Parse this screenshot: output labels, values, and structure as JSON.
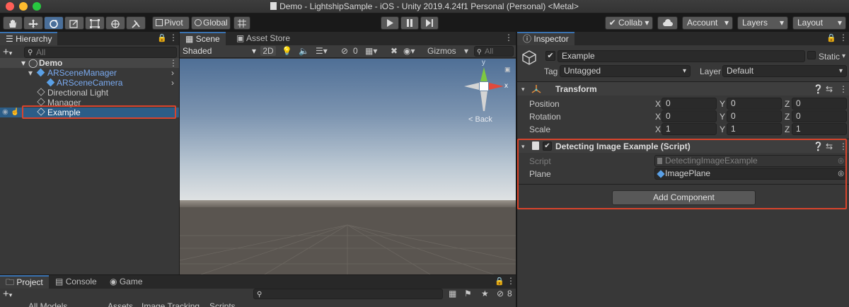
{
  "window": {
    "title": "Demo - LightshipSample - iOS - Unity 2019.4.24f1 Personal (Personal) <Metal>"
  },
  "toolbar": {
    "pivot_label": "Pivot",
    "global_label": "Global",
    "collab_label": "Collab",
    "account_label": "Account",
    "layers_label": "Layers",
    "layout_label": "Layout"
  },
  "hierarchy": {
    "tab_label": "Hierarchy",
    "search_placeholder": "All",
    "items": [
      {
        "label": "Demo"
      },
      {
        "label": "ARSceneManager"
      },
      {
        "label": "ARSceneCamera"
      },
      {
        "label": "Directional Light"
      },
      {
        "label": "Manager"
      },
      {
        "label": "Example"
      }
    ]
  },
  "scene": {
    "tabs": [
      "Scene",
      "Asset Store"
    ],
    "shading_mode": "Shaded",
    "mode_2d": "2D",
    "hidden_count": "0",
    "gizmos_label": "Gizmos",
    "search_placeholder": "All",
    "gizmo_y": "y",
    "gizmo_x": "x",
    "back_label": "< Back"
  },
  "inspector": {
    "tab_label": "Inspector",
    "object_name": "Example",
    "static_label": "Static",
    "tag_label": "Tag",
    "tag_value": "Untagged",
    "layer_label": "Layer",
    "layer_value": "Default",
    "transform": {
      "title": "Transform",
      "rows": [
        {
          "label": "Position",
          "x": "0",
          "y": "0",
          "z": "0"
        },
        {
          "label": "Rotation",
          "x": "0",
          "y": "0",
          "z": "0"
        },
        {
          "label": "Scale",
          "x": "1",
          "y": "1",
          "z": "1"
        }
      ],
      "axis_x": "X",
      "axis_y": "Y",
      "axis_z": "Z"
    },
    "script_component": {
      "title": "Detecting Image Example (Script)",
      "script_label": "Script",
      "script_value": "DetectingImageExample",
      "plane_label": "Plane",
      "plane_value": "ImagePlane"
    },
    "add_component_label": "Add Component"
  },
  "bottom": {
    "tabs": [
      "Project",
      "Console",
      "Game"
    ],
    "hidden_count": "8",
    "breadcrumb": [
      "All Models",
      "Assets",
      "Image Tracking",
      "Scripts"
    ]
  },
  "colors": {
    "selection_blue": "#2c5d87",
    "highlight_red": "#d9442c",
    "sky_top": "#4f6f96",
    "ground": "#5a5550"
  }
}
